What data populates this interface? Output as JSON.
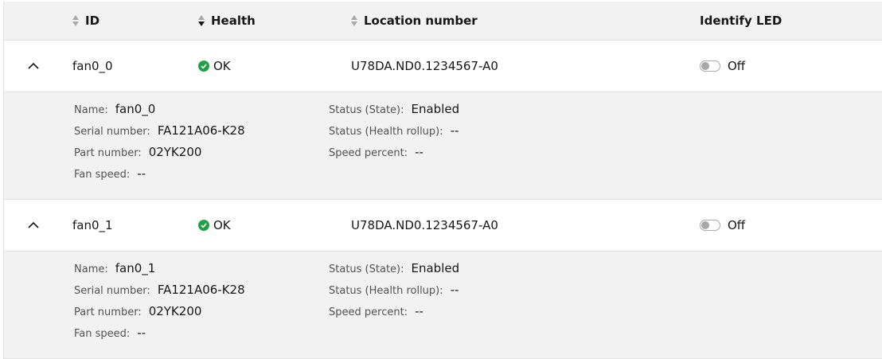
{
  "header": {
    "id": "ID",
    "health": "Health",
    "location": "Location number",
    "identify_led": "Identify LED"
  },
  "rows": [
    {
      "id": "fan0_0",
      "health": "OK",
      "location": "U78DA.ND0.1234567-A0",
      "led_state": "Off",
      "details": {
        "name_label": "Name:",
        "name_value": "fan0_0",
        "serial_label": "Serial number:",
        "serial_value": "FA121A06-K28",
        "part_label": "Part number:",
        "part_value": "02YK200",
        "speed_label": "Fan speed:",
        "speed_value": "--",
        "state_label": "Status (State):",
        "state_value": "Enabled",
        "rollup_label": "Status (Health rollup):",
        "rollup_value": "--",
        "percent_label": "Speed percent:",
        "percent_value": "--"
      }
    },
    {
      "id": "fan0_1",
      "health": "OK",
      "location": "U78DA.ND0.1234567-A0",
      "led_state": "Off",
      "details": {
        "name_label": "Name:",
        "name_value": "fan0_1",
        "serial_label": "Serial number:",
        "serial_value": "FA121A06-K28",
        "part_label": "Part number:",
        "part_value": "02YK200",
        "speed_label": "Fan speed:",
        "speed_value": "--",
        "state_label": "Status (State):",
        "state_value": "Enabled",
        "rollup_label": "Status (Health rollup):",
        "rollup_value": "--",
        "percent_label": "Speed percent:",
        "percent_value": "--"
      }
    }
  ],
  "colors": {
    "ok": "#24a148",
    "header_bg": "#f2f2f2",
    "detail_bg": "#f2f2f2"
  },
  "icons": {
    "expand": "chevron-up-icon",
    "health": "checkmark-filled-icon",
    "sort": "arrows-vertical-icon"
  }
}
